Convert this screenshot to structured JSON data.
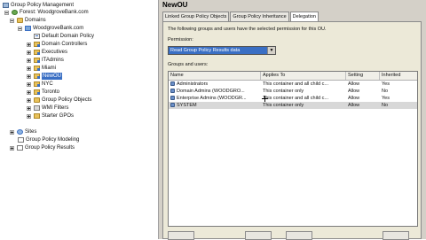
{
  "tree": {
    "root": "Group Policy Management",
    "forest": "Forest: WoodgroveBank.com",
    "domains": "Domains",
    "domain": "WoodgroveBank.com",
    "children": [
      {
        "label": "Default Domain Policy",
        "icon": "gpo-link-icon",
        "expander": false
      },
      {
        "label": "Domain Controllers",
        "icon": "ou-folder-icon",
        "expander": true
      },
      {
        "label": "Executives",
        "icon": "ou-folder-icon",
        "expander": true
      },
      {
        "label": "ITAdmins",
        "icon": "ou-folder-icon",
        "expander": true
      },
      {
        "label": "Miami",
        "icon": "ou-folder-icon",
        "expander": true
      },
      {
        "label": "NewOU",
        "icon": "ou-folder-icon",
        "expander": true,
        "selected": true
      },
      {
        "label": "NYC",
        "icon": "ou-folder-icon",
        "expander": true
      },
      {
        "label": "Toronto",
        "icon": "ou-folder-icon",
        "expander": true
      },
      {
        "label": "Group Policy Objects",
        "icon": "folder-icon",
        "expander": true
      },
      {
        "label": "WMI Filters",
        "icon": "wmi-folder-icon",
        "expander": true
      },
      {
        "label": "Starter GPOs",
        "icon": "starter-folder-icon",
        "expander": true
      }
    ],
    "sites": "Sites",
    "modeling": "Group Policy Modeling",
    "results": "Group Policy Results"
  },
  "details": {
    "title": "NewOU",
    "tabs": [
      "Linked Group Policy Objects",
      "Group Policy Inheritance",
      "Delegation"
    ],
    "active_tab": 2,
    "description": "The following groups and users have the selected permission for this OU.",
    "permission_label": "Permission:",
    "permission_value": "Read Group Policy Results data",
    "groups_label": "Groups and users:",
    "columns": [
      "Name",
      "Applies To",
      "Setting",
      "Inherited"
    ],
    "rows": [
      {
        "name": "Administrators",
        "applies": "This container and all child c...",
        "setting": "Allow",
        "inherited": "Yes"
      },
      {
        "name": "Domain Admins (WOODGRO...",
        "applies": "This container only",
        "setting": "Allow",
        "inherited": "No"
      },
      {
        "name": "Enterprise Admins (WOODGR...",
        "applies": "This container and all child c...",
        "setting": "Allow",
        "inherited": "Yes"
      },
      {
        "name": "SYSTEM",
        "applies": "This container only",
        "setting": "Allow",
        "inherited": "No"
      }
    ]
  }
}
